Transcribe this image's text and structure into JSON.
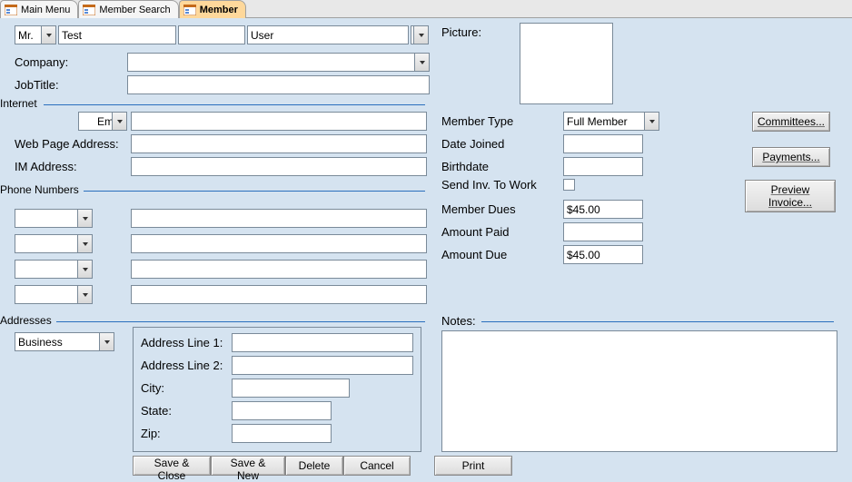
{
  "tabs": {
    "main_menu": "Main Menu",
    "member_search": "Member Search",
    "member": "Member"
  },
  "name_row": {
    "title": "Mr.",
    "first": "Test",
    "middle": "",
    "last": "User"
  },
  "labels": {
    "company": "Company:",
    "jobtitle": "JobTitle:",
    "picture": "Picture:",
    "email_combo": "Email",
    "web_page": "Web Page Address:",
    "im_address": "IM Address:",
    "member_type": "Member Type",
    "date_joined": "Date Joined",
    "birthdate": "Birthdate",
    "send_inv": "Send Inv. To Work",
    "member_dues": "Member Dues",
    "amount_paid": "Amount Paid",
    "amount_due": "Amount Due",
    "notes": "Notes:",
    "addr_line1": "Address Line 1:",
    "addr_line2": "Address Line 2:",
    "city": "City:",
    "state": "State:",
    "zip": "Zip:",
    "addr_type": "Business"
  },
  "sections": {
    "internet": "Internet",
    "phone_numbers": "Phone Numbers",
    "addresses": "Addresses"
  },
  "values": {
    "company": "",
    "jobtitle": "",
    "email": "",
    "web_page": "",
    "im_address": "",
    "member_type": "Full Member",
    "date_joined": "",
    "birthdate": "",
    "member_dues": "$45.00",
    "amount_paid": "",
    "amount_due": "$45.00",
    "addr_line1": "",
    "addr_line2": "",
    "city": "",
    "state": "",
    "zip": "",
    "notes": "",
    "phone_type1": "",
    "phone_val1": "",
    "phone_type2": "",
    "phone_val2": "",
    "phone_type3": "",
    "phone_val3": "",
    "phone_type4": "",
    "phone_val4": ""
  },
  "actions": {
    "committees": "Committees...",
    "committees_u": "C",
    "payments": "Payments...",
    "payments_u": "P",
    "preview_invoice": "Preview Invoice...",
    "preview_invoice_u": "P",
    "save_close": "Save & Close",
    "save_new": "Save & New",
    "delete": "Delete",
    "cancel": "Cancel",
    "print": "Print"
  }
}
